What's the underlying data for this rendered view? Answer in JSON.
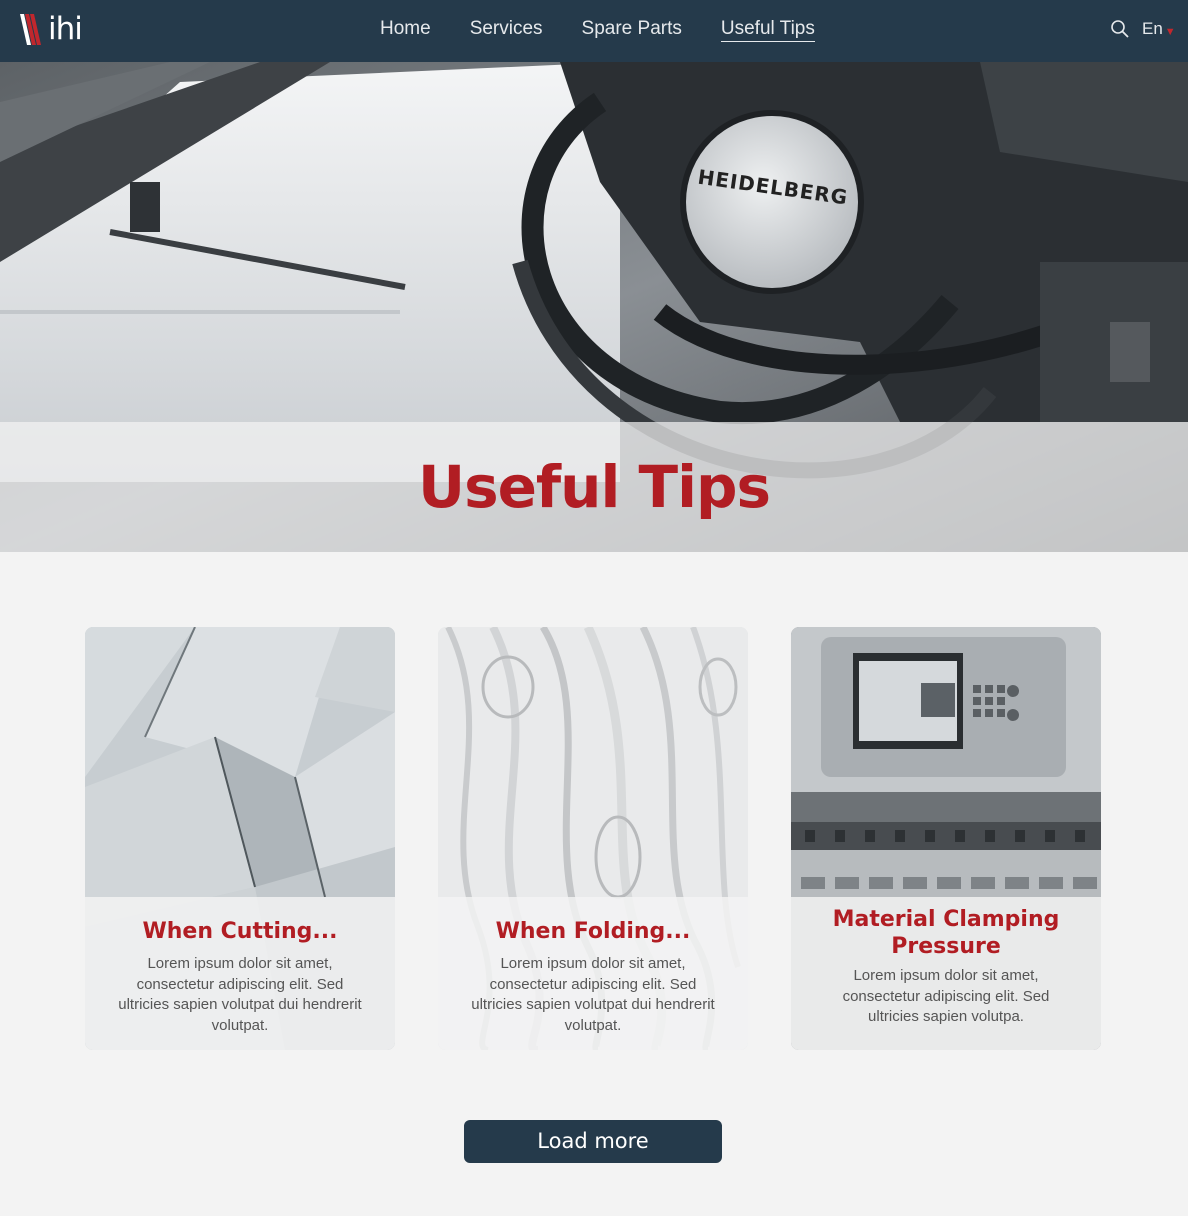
{
  "brand": {
    "logo_text": "ihi",
    "accent": "#b11d23",
    "nav_bg": "#253a4b"
  },
  "nav": {
    "items": [
      {
        "label": "Home"
      },
      {
        "label": "Services"
      },
      {
        "label": "Spare Parts"
      },
      {
        "label": "Useful Tips",
        "active": true
      }
    ],
    "search_icon": "search-icon",
    "language": "En"
  },
  "hero": {
    "title": "Useful Tips",
    "machine_brand": "HEIDELBERG"
  },
  "cards": [
    {
      "title": "When Cutting...",
      "text": "Lorem ipsum dolor sit amet, consectetur adipiscing elit. Sed ultricies sapien volutpat dui hendrerit volutpat."
    },
    {
      "title": "When Folding...",
      "text": "Lorem ipsum dolor sit amet, consectetur adipiscing elit. Sed ultricies sapien volutpat dui hendrerit volutpat."
    },
    {
      "title": "Material Clamping Pressure",
      "text": "Lorem ipsum dolor sit amet, consectetur adipiscing elit. Sed ultricies sapien volutpa."
    }
  ],
  "load_more": "Load more"
}
